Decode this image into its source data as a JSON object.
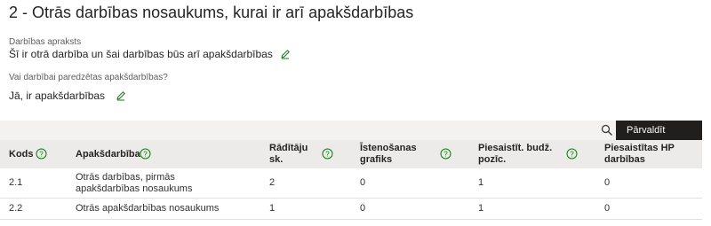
{
  "section": {
    "title": "2 - Otrās darbības nosaukums, kurai ir arī apakšdarbības"
  },
  "description": {
    "label": "Darbības apraksts",
    "value": "Šī ir otrā darbība un šai darbības būs arī apakšdarbības"
  },
  "has_subactivities": {
    "label": "Vai darbībai paredzētas apakšdarbības?",
    "value": "Jā, ir apakšdarbības"
  },
  "toolbar": {
    "manage_label": "Pārvaldīt"
  },
  "table": {
    "columns": [
      "Kods",
      "Apakšdarbība",
      "Rādītāju sk.",
      "Īstenošanas grafiks",
      "Piesaistīt. budž. pozīc.",
      "Piesaistītas HP darbības"
    ],
    "rows": [
      [
        "2.1",
        "Otrās darbības, pirmās apakšdarbības nosaukums",
        "2",
        "0",
        "1",
        "0"
      ],
      [
        "2.2",
        "Otrās apakšdarbības nosaukums",
        "1",
        "0",
        "1",
        "0"
      ]
    ]
  },
  "icons": {
    "edit": "pencil-icon",
    "help": "question-circle-icon",
    "search": "search-icon"
  },
  "colors": {
    "manage_button_bg": "#201f1e",
    "help_icon": "#107c10",
    "edit_icon": "#107c10",
    "header_bg": "#edebe9",
    "toolbar_bg": "#f3f2f1"
  }
}
